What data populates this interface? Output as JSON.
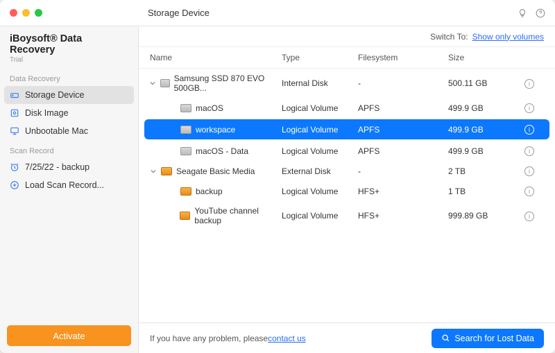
{
  "titlebar": {
    "title": "Storage Device"
  },
  "brand": {
    "name": "iBoysoft® Data Recovery",
    "sub": "Trial"
  },
  "sidebar": {
    "sections": [
      {
        "header": "Data Recovery",
        "items": [
          {
            "label": "Storage Device",
            "icon": "storage-icon",
            "active": true
          },
          {
            "label": "Disk Image",
            "icon": "disk-image-icon",
            "active": false
          },
          {
            "label": "Unbootable Mac",
            "icon": "monitor-icon",
            "active": false
          }
        ]
      },
      {
        "header": "Scan Record",
        "items": [
          {
            "label": "7/25/22 - backup",
            "icon": "clock-icon",
            "active": false
          },
          {
            "label": "Load Scan Record...",
            "icon": "plus-circle-icon",
            "active": false
          }
        ]
      }
    ],
    "activate": "Activate"
  },
  "switch": {
    "label": "Switch To:",
    "link": "Show only volumes"
  },
  "columns": {
    "name": "Name",
    "type": "Type",
    "fs": "Filesystem",
    "size": "Size"
  },
  "rows": [
    {
      "indent": 0,
      "expand": true,
      "icon": "int",
      "name": "Samsung SSD 870 EVO 500GB...",
      "type": "Internal Disk",
      "fs": "-",
      "size": "500.11 GB",
      "selected": false
    },
    {
      "indent": 1,
      "expand": null,
      "icon": "int",
      "name": "macOS",
      "type": "Logical Volume",
      "fs": "APFS",
      "size": "499.9 GB",
      "selected": false
    },
    {
      "indent": 1,
      "expand": null,
      "icon": "int",
      "name": "workspace",
      "type": "Logical Volume",
      "fs": "APFS",
      "size": "499.9 GB",
      "selected": true
    },
    {
      "indent": 1,
      "expand": null,
      "icon": "int",
      "name": "macOS - Data",
      "type": "Logical Volume",
      "fs": "APFS",
      "size": "499.9 GB",
      "selected": false
    },
    {
      "indent": 0,
      "expand": true,
      "icon": "ext",
      "name": "Seagate Basic Media",
      "type": "External Disk",
      "fs": "-",
      "size": "2 TB",
      "selected": false
    },
    {
      "indent": 1,
      "expand": null,
      "icon": "ext",
      "name": "backup",
      "type": "Logical Volume",
      "fs": "HFS+",
      "size": "1 TB",
      "selected": false
    },
    {
      "indent": 1,
      "expand": null,
      "icon": "ext",
      "name": "YouTube channel backup",
      "type": "Logical Volume",
      "fs": "HFS+",
      "size": "999.89 GB",
      "selected": false
    }
  ],
  "footer": {
    "text": "If you have any problem, please ",
    "link": "contact us",
    "search": "Search for Lost Data"
  }
}
